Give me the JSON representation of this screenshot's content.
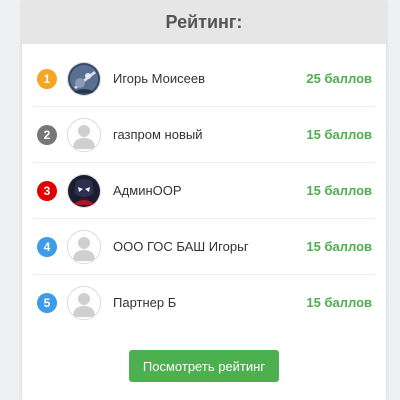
{
  "rating": {
    "title": "Рейтинг:",
    "button_label": "Посмотреть рейтинг",
    "items": [
      {
        "rank": "1",
        "rank_color": "#f5a623",
        "avatar": "photo-avatar-guitar",
        "name": "Игорь Моисеев",
        "points": "25 баллов"
      },
      {
        "rank": "2",
        "rank_color": "#777777",
        "avatar": "default-user-icon",
        "name": "газпром новый",
        "points": "15 баллов"
      },
      {
        "rank": "3",
        "rank_color": "#e00000",
        "avatar": "photo-avatar-spiderman",
        "name": "АдминООР",
        "points": "15 баллов"
      },
      {
        "rank": "4",
        "rank_color": "#3d9be9",
        "avatar": "default-user-icon",
        "name": "ООО ГОС БАШ Игорьг",
        "points": "15 баллов"
      },
      {
        "rank": "5",
        "rank_color": "#3d9be9",
        "avatar": "default-user-icon",
        "name": "Партнер Б",
        "points": "15 баллов"
      }
    ]
  }
}
